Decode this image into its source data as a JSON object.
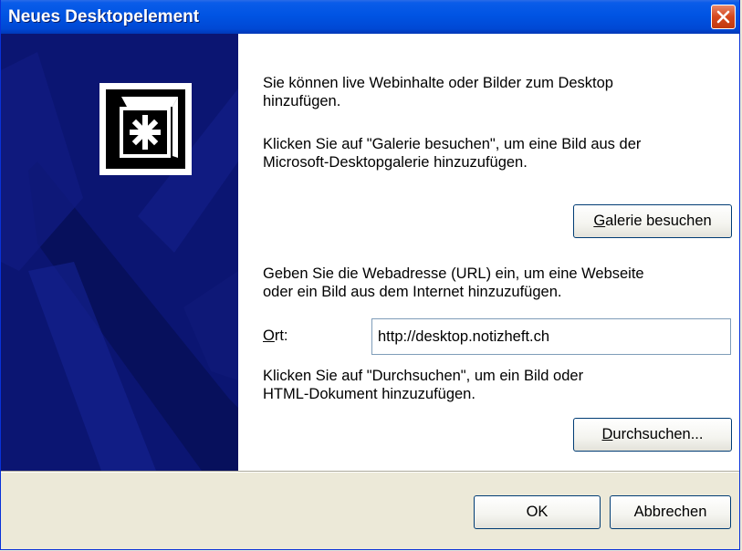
{
  "window": {
    "title": "Neues Desktopelement"
  },
  "intro": {
    "line1": "Sie können live Webinhalte oder Bilder zum Desktop",
    "line2": "hinzufügen."
  },
  "gallery": {
    "line1": "Klicken Sie auf \"Galerie besuchen\", um eine Bild aus der",
    "line2": "Microsoft-Desktopgalerie hinzuzufügen.",
    "button_mnemonic": "G",
    "button_rest": "alerie besuchen"
  },
  "url_section": {
    "line1": "Geben Sie die Webadresse (URL) ein, um eine Webseite",
    "line2": "oder ein Bild aus dem Internet hinzuzufügen.",
    "location_mnemonic": "O",
    "location_rest": "rt:",
    "location_value": "http://desktop.notizheft.ch"
  },
  "browse": {
    "line1": "Klicken Sie auf \"Durchsuchen\", um ein Bild oder",
    "line2": "HTML-Dokument hinzuzufügen.",
    "button_mnemonic": "D",
    "button_rest": "urchsuchen..."
  },
  "footer": {
    "ok_label": "OK",
    "cancel_label": "Abbrechen"
  },
  "colors": {
    "titlebar": "#0054e3",
    "panel": "#0b1572",
    "dialog_bg": "#ece9d8",
    "close": "#d5471c"
  },
  "icons": {
    "logo": "active-desktop-icon",
    "close": "close-icon"
  }
}
